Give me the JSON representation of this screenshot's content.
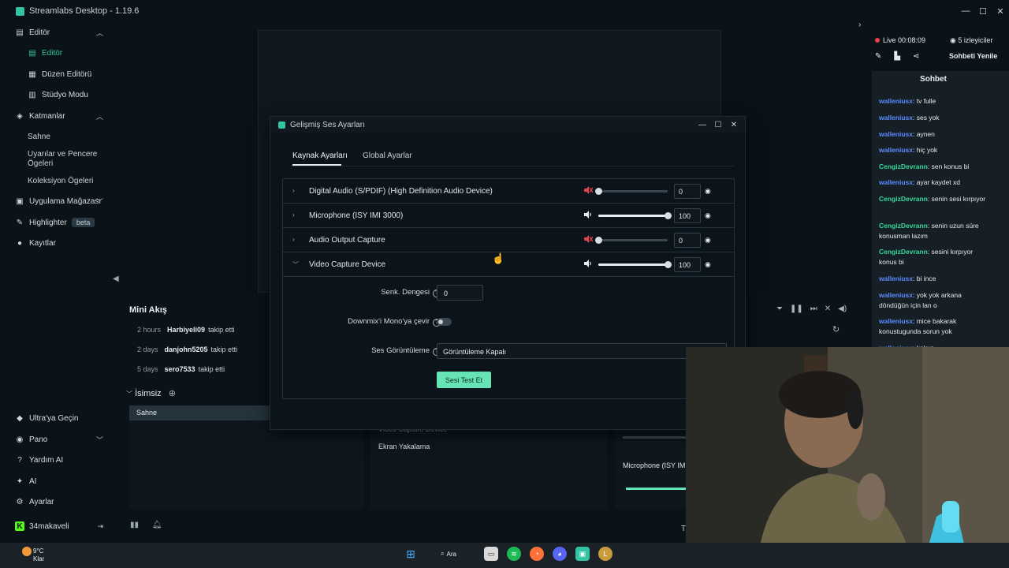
{
  "window": {
    "title": "Streamlabs Desktop - 1.19.6"
  },
  "sidebar": {
    "sections": [
      {
        "label": "Editör",
        "icon": "editor-icon"
      },
      {
        "label": "Katmanlar",
        "icon": "layers-icon"
      },
      {
        "label": "Uygulama Mağazası",
        "icon": "store-icon"
      },
      {
        "label": "Highlighter",
        "icon": "highlighter-icon",
        "badge": "beta"
      },
      {
        "label": "Kayıtlar",
        "icon": "recordings-icon"
      }
    ],
    "editor_items": [
      {
        "label": "Editör",
        "active": true
      },
      {
        "label": "Düzen Editörü"
      },
      {
        "label": "Stüdyo Modu"
      }
    ],
    "layer_items": [
      "Sahne",
      "Uyarılar ve Pencere",
      "Ögeleri",
      "Koleksiyon Ögeleri"
    ],
    "bottom_items": [
      {
        "label": "Ultra'ya Geçin",
        "icon": "ultra-icon"
      },
      {
        "label": "Pano",
        "icon": "dashboard-icon"
      },
      {
        "label": "Yardım AI",
        "icon": "help-ai-icon"
      },
      {
        "label": "AI",
        "icon": "ai-icon"
      },
      {
        "label": "Ayarlar",
        "icon": "settings-icon"
      },
      {
        "label": "34makaveli",
        "icon": "kick-icon"
      }
    ]
  },
  "mini_feed": {
    "title": "Mini Akış",
    "events": [
      {
        "time": "2 hours",
        "user": "Harbiyeli09",
        "action": "takip etti"
      },
      {
        "time": "2 days",
        "user": "danjohn5205",
        "action": "takip etti"
      },
      {
        "time": "5 days",
        "user": "sero7533",
        "action": "takip etti"
      }
    ]
  },
  "scenes": {
    "collection": "İsimsiz",
    "items": [
      "Sahne"
    ]
  },
  "sources": {
    "items": [
      "Video Capture Device",
      "Ekran Yakalama"
    ]
  },
  "mixer": {
    "label": "Microphone (ISY IM"
  },
  "app_bottom": {
    "tv_text": "T"
  },
  "chat": {
    "live": "Live 00:08:09",
    "viewers": "5 izleyiciler",
    "refresh": "Sohbeti Yenile",
    "title": "Sohbet",
    "messages": [
      {
        "user": "walleniusx",
        "text": ": tv fulle",
        "color": "blue"
      },
      {
        "user": "walleniusx",
        "text": ": ses yok",
        "color": "blue"
      },
      {
        "user": "walleniusx",
        "text": ": aynen",
        "color": "blue"
      },
      {
        "user": "walleniusx",
        "text": ": hiç yok",
        "color": "blue"
      },
      {
        "user": "CengizDevrann",
        "text": ": sen konus bi",
        "color": "green"
      },
      {
        "user": "walleniusx",
        "text": ": ayar kaydet xd",
        "color": "blue"
      },
      {
        "user": "CengizDevrann",
        "text": ": senin sesi kırpıyor",
        "color": "green"
      },
      {
        "user": "CengizDevrann",
        "text": ": senin uzun süre konusman lazım",
        "color": "green"
      },
      {
        "user": "CengizDevrann",
        "text": ": sesini kırpıyor konus bi",
        "color": "green"
      },
      {
        "user": "walleniusx",
        "text": ": bi ince",
        "color": "blue"
      },
      {
        "user": "walleniusx",
        "text": ": yok yok arkana döndüğün için lan o",
        "color": "blue"
      },
      {
        "user": "walleniusx",
        "text": ": mice bakarak konustugunda sorun yok",
        "color": "blue"
      },
      {
        "user": "walleniusx",
        "text": ": kalsın",
        "color": "blue"
      }
    ]
  },
  "dialog": {
    "title": "Gelişmiş Ses Ayarları",
    "tabs": [
      "Kaynak Ayarları",
      "Global Ayarlar"
    ],
    "sources": [
      {
        "name": "Digital Audio (S/PDIF) (High Definition Audio Device)",
        "muted": true,
        "volume": 0
      },
      {
        "name": "Microphone (ISY IMI 3000)",
        "muted": false,
        "volume": 100
      },
      {
        "name": "Audio Output Capture",
        "muted": true,
        "volume": 0
      },
      {
        "name": "Video Capture Device",
        "muted": false,
        "volume": 100,
        "expanded": true
      }
    ],
    "fields": {
      "sync_label": "Senk. Dengesi",
      "sync_value": "0",
      "downmix_label": "Downmix'i Mono'ya çevir",
      "downmix_on": false,
      "monitor_label": "Ses Görüntüleme",
      "monitor_value": "Görüntüleme Kapalı"
    },
    "test_button": "Sesi Test Et"
  },
  "taskbar": {
    "temp": "9°C",
    "weather": "Klar",
    "search": "Ara"
  },
  "colors": {
    "accent": "#31c3a2",
    "button": "#67e4b6",
    "live": "#ea3f4f",
    "user_blue": "#5b8cff",
    "user_green": "#38d79a"
  }
}
